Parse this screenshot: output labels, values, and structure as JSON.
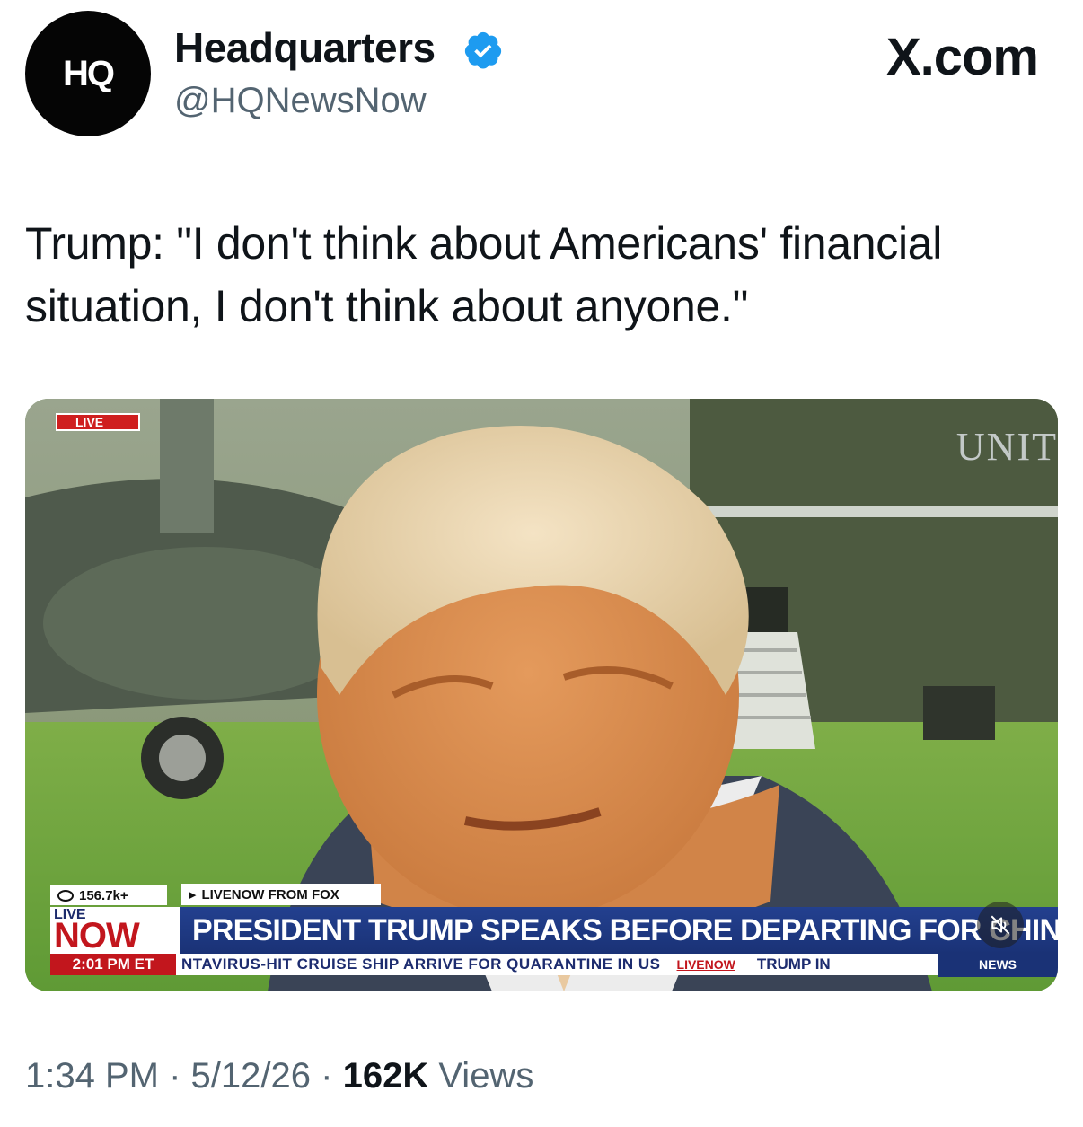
{
  "author": {
    "display_name": "Headquarters",
    "handle": "@HQNewsNow",
    "avatar_text": "HQ",
    "verified_color": "#1d9bf0"
  },
  "site_mark": "X.com",
  "tweet_text": "Trump: \"I don't think about Americans' financial situation, I don't think about anyone.\"",
  "video": {
    "live_badge": "LIVE",
    "background_text": "UNIT",
    "viewers": "156.7k+",
    "source": "LIVENOW FROM FOX",
    "livenow_small": "LIVE",
    "livenow_big": "NOW",
    "time": "2:01 PM ET",
    "headline": "PRESIDENT TRUMP SPEAKS BEFORE DEPARTING FOR CHIN",
    "ticker": "NTAVIRUS-HIT CRUISE SHIP ARRIVE FOR QUARANTINE IN US",
    "ticker_livenow": "LIVENOW",
    "ticker_second": "TRUMP IN",
    "news_logo": "NEWS",
    "mute_icon": "mute-icon"
  },
  "meta": {
    "time": "1:34 PM",
    "separator": "·",
    "date": "5/12/26",
    "views_count": "162K",
    "views_label": "Views"
  },
  "colors": {
    "text_primary": "#0f1419",
    "text_secondary": "#536471",
    "fox_red": "#c2161d",
    "fox_blue": "#1a3276"
  }
}
